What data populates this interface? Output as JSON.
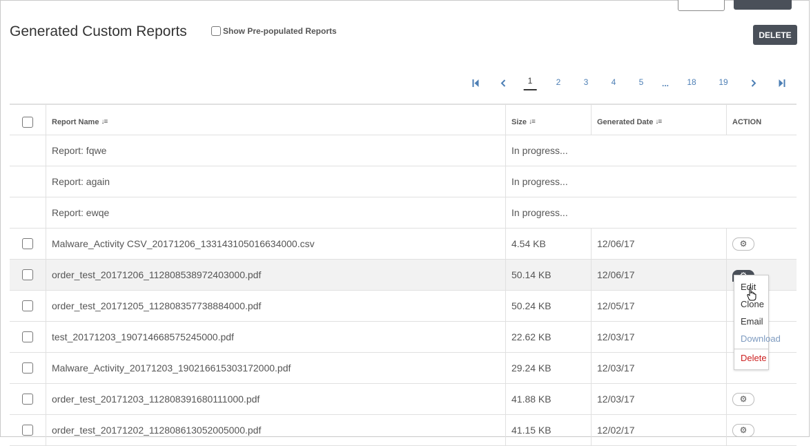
{
  "page": {
    "title": "Generated Custom Reports",
    "show_prepopulated_label": "Show Pre-populated Reports",
    "delete_label": "DELETE"
  },
  "pagination": {
    "current": "1",
    "pages": [
      "1",
      "2",
      "3",
      "4",
      "5",
      "...",
      "18",
      "19"
    ],
    "first_icon": "first-page-icon",
    "prev_icon": "chevron-left-icon",
    "next_icon": "chevron-right-icon",
    "last_icon": "last-page-icon"
  },
  "table": {
    "columns": [
      "Report Name",
      "Size",
      "Generated Date",
      "ACTION"
    ],
    "in_progress": [
      {
        "name": "Report: fqwe",
        "status": "In progress..."
      },
      {
        "name": "Report: again",
        "status": "In progress..."
      },
      {
        "name": "Report: ewqe",
        "status": "In progress..."
      }
    ],
    "rows": [
      {
        "name": "Malware_Activity CSV_20171206_133143105016634000.csv",
        "size": "4.54 KB",
        "date": "12/06/17"
      },
      {
        "name": "order_test_20171206_112808538972403000.pdf",
        "size": "50.14 KB",
        "date": "12/06/17"
      },
      {
        "name": "order_test_20171205_112808357738884000.pdf",
        "size": "50.24 KB",
        "date": "12/05/17"
      },
      {
        "name": "test_20171203_190714668575245000.pdf",
        "size": "22.62 KB",
        "date": "12/03/17"
      },
      {
        "name": "Malware_Activity_20171203_190216615303172000.pdf",
        "size": "29.24 KB",
        "date": "12/03/17"
      },
      {
        "name": "order_test_20171203_112808391680111000.pdf",
        "size": "41.88 KB",
        "date": "12/03/17"
      },
      {
        "name": "order_test_20171202_112808613052005000.pdf",
        "size": "41.15 KB",
        "date": "12/02/17"
      }
    ]
  },
  "action_menu": {
    "items": [
      "Edit",
      "Clone",
      "Email",
      "Download",
      "Delete"
    ]
  },
  "colors": {
    "dark_button": "#4a5059",
    "link": "#4d7fb5",
    "delete_red": "#cc1f1f"
  }
}
